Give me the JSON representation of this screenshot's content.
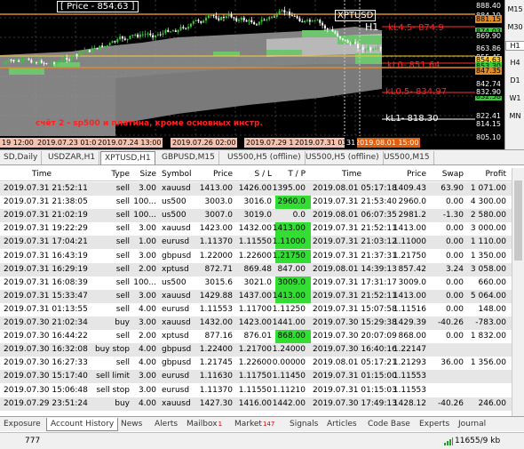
{
  "chart": {
    "price_title": "[ Price - 854.63 ]",
    "symbol_label": "XPTUSD",
    "timeframe_label": "H1",
    "annotation": "счёт 2 - sp500 и платина, кроме основных инстр.",
    "levels": [
      {
        "label": "kL4.5- 874.9",
        "color": "#ff2020"
      },
      {
        "label": "kL0- 851.64",
        "color": "#ff2020"
      },
      {
        "label": "kL0.5- 834.97",
        "color": "#ff2020"
      },
      {
        "label": "kL1- 818.30",
        "color": "#ffffff"
      }
    ],
    "price_axis": [
      {
        "label": "888.40",
        "style": "plain"
      },
      {
        "label": "884.19",
        "style": "plain"
      },
      {
        "label": "881.15",
        "style": "orange"
      },
      {
        "label": "874.03",
        "style": "green"
      },
      {
        "label": "869.90",
        "style": "plain"
      },
      {
        "label": "863.86",
        "style": "plain"
      },
      {
        "label": "855.45",
        "style": "plain"
      },
      {
        "label": "854.63",
        "style": "yellow"
      },
      {
        "label": "853.30",
        "style": "green"
      },
      {
        "label": "847.35",
        "style": "orange"
      },
      {
        "label": "842.74",
        "style": "plain"
      },
      {
        "label": "832.58",
        "style": "green"
      },
      {
        "label": "832.90",
        "style": "plain"
      },
      {
        "label": "822.41",
        "style": "plain"
      },
      {
        "label": "814.15",
        "style": "plain"
      },
      {
        "label": "805.10",
        "style": "plain"
      }
    ],
    "time_labels": [
      "19 12:00",
      "2019.07.23 01:00",
      "2019.07.24 13:00",
      "2019.07.26 02:00",
      "2019.07.29 14:00",
      "2019.07.31 03:00",
      "2019.08.01 15:00"
    ],
    "time_cursor_value": "31"
  },
  "timeframes": [
    "M15",
    "M30",
    "H1",
    "H4",
    "D1",
    "W1",
    "MN"
  ],
  "active_timeframe": "H1",
  "chart_tabs": [
    "SD,Daily",
    "USDZAR,H1",
    "XPTUSD,H1",
    "GBPUSD,M15",
    "US500,H5 (offline)",
    "US500,H5 (offline)",
    "US500,M15"
  ],
  "active_chart_tab": "XPTUSD,H1",
  "table": {
    "columns": [
      "Time",
      "Type",
      "Size",
      "Symbol",
      "Price",
      "S / L",
      "T / P",
      "Time",
      "Price",
      "Swap",
      "Profit"
    ],
    "rows": [
      [
        "2019.07.31 21:52:11",
        "sell",
        "3.00",
        "xauusd",
        "1413.00",
        "1426.00",
        "1395.00",
        "2019.08.01 05:17:18",
        "1409.43",
        "63.90",
        "1 071.00"
      ],
      [
        "2019.07.31 21:38:05",
        "sell",
        "100...",
        "us500",
        "3003.0",
        "3016.0",
        "2960.0",
        "2019.07.31 21:53:40",
        "2960.0",
        "0.00",
        "4 300.00"
      ],
      [
        "2019.07.31 21:02:19",
        "sell",
        "100...",
        "us500",
        "3007.0",
        "3019.0",
        "0.0",
        "2019.08.01 06:07:35",
        "2981.2",
        "-1.30",
        "2 580.00"
      ],
      [
        "2019.07.31 19:22:29",
        "sell",
        "3.00",
        "xauusd",
        "1423.00",
        "1432.00",
        "1413.00",
        "2019.07.31 21:52:11",
        "1413.00",
        "0.00",
        "3 000.00"
      ],
      [
        "2019.07.31 17:04:21",
        "sell",
        "1.00",
        "eurusd",
        "1.11370",
        "1.11550",
        "1.11000",
        "2019.07.31 21:03:12",
        "1.11000",
        "0.00",
        "1 110.00"
      ],
      [
        "2019.07.31 16:43:19",
        "sell",
        "3.00",
        "gbpusd",
        "1.22000",
        "1.22600",
        "1.21750",
        "2019.07.31 21:37:31",
        "1.21750",
        "0.00",
        "1 350.00"
      ],
      [
        "2019.07.31 16:29:19",
        "sell",
        "2.00",
        "xptusd",
        "872.71",
        "869.48",
        "847.00",
        "2019.08.01 14:39:13",
        "857.42",
        "3.24",
        "3 058.00"
      ],
      [
        "2019.07.31 16:08:39",
        "sell",
        "100...",
        "us500",
        "3015.6",
        "3021.0",
        "3009.0",
        "2019.07.31 17:31:17",
        "3009.0",
        "0.00",
        "660.00"
      ],
      [
        "2019.07.31 15:33:47",
        "sell",
        "3.00",
        "xauusd",
        "1429.88",
        "1437.00",
        "1413.00",
        "2019.07.31 21:52:11",
        "1413.00",
        "0.00",
        "5 064.00"
      ],
      [
        "2019.07.31 01:13:55",
        "sell",
        "4.00",
        "eurusd",
        "1.11553",
        "1.11700",
        "1.11250",
        "2019.07.31 15:07:58",
        "1.11516",
        "0.00",
        "148.00"
      ],
      [
        "2019.07.30 21:02:34",
        "buy",
        "3.00",
        "xauusd",
        "1432.00",
        "1423.00",
        "1441.00",
        "2019.07.30 15:29:38",
        "1429.39",
        "-40.26",
        "-783.00"
      ],
      [
        "2019.07.30 16:44:22",
        "sell",
        "2.00",
        "xptusd",
        "877.16",
        "876.01",
        "868.00",
        "2019.07.30 20:07:09",
        "868.00",
        "0.00",
        "1 832.00"
      ],
      [
        "2019.07.30 16:32:08",
        "buy stop",
        "4.00",
        "gbpusd",
        "1.22400",
        "1.21700",
        "1.24000",
        "2019.07.30 16:40:16",
        "1.22147",
        "",
        ""
      ],
      [
        "2019.07.30 16:27:33",
        "sell",
        "4.00",
        "gbpusd",
        "1.21745",
        "1.22600",
        "0.00000",
        "2019.08.01 05:17:21",
        "1.21293",
        "36.00",
        "1 356.00"
      ],
      [
        "2019.07.30 15:17:40",
        "sell limit",
        "3.00",
        "eurusd",
        "1.11630",
        "1.11750",
        "1.11450",
        "2019.07.31 01:15:00",
        "1.11553",
        "",
        ""
      ],
      [
        "2019.07.30 15:06:48",
        "sell stop",
        "3.00",
        "eurusd",
        "1.11370",
        "1.11550",
        "1.11210",
        "2019.07.31 01:15:03",
        "1.11553",
        "",
        ""
      ],
      [
        "2019.07.29 23:51:24",
        "buy",
        "4.00",
        "xauusd",
        "1427.30",
        "1416.00",
        "1442.00",
        "2019.07.30 17:49:13",
        "1428.12",
        "-40.26",
        "246.00"
      ]
    ],
    "highlight_color": "#33dd33",
    "highlights": [
      [
        1,
        6
      ],
      [
        3,
        6
      ],
      [
        4,
        6
      ],
      [
        5,
        6
      ],
      [
        7,
        6
      ],
      [
        8,
        6
      ],
      [
        11,
        6
      ]
    ]
  },
  "bottom_tabs": [
    {
      "label": "Exposure",
      "badge": ""
    },
    {
      "label": "Account History",
      "badge": ""
    },
    {
      "label": "News",
      "badge": ""
    },
    {
      "label": "Alerts",
      "badge": ""
    },
    {
      "label": "Mailbox",
      "badge": "1"
    },
    {
      "label": "Market",
      "badge": "147"
    },
    {
      "label": "Signals",
      "badge": ""
    },
    {
      "label": "Articles",
      "badge": ""
    },
    {
      "label": "Code Base",
      "badge": ""
    },
    {
      "label": "Experts",
      "badge": ""
    },
    {
      "label": "Journal",
      "badge": ""
    }
  ],
  "active_bottom_tab": "Account History",
  "status": {
    "left": "777",
    "right": "11655/9 kb"
  }
}
